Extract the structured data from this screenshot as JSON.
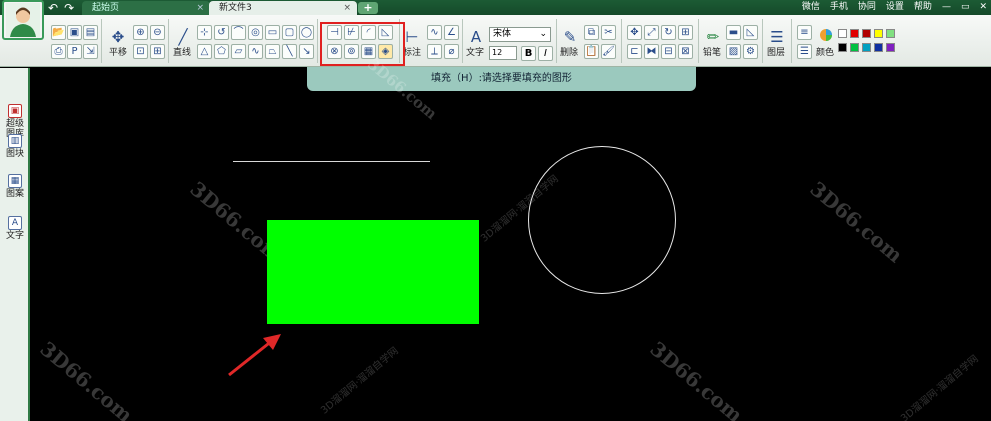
{
  "titlebar": {
    "tabs": [
      {
        "label": "起始页",
        "close": "×"
      },
      {
        "label": "新文件3",
        "close": "×"
      }
    ],
    "add_tab": "+",
    "right_items": [
      "微信",
      "手机",
      "协同",
      "设置",
      "帮助"
    ],
    "window_controls": [
      "—",
      "▭",
      "✕"
    ]
  },
  "ribbon": {
    "pan_label": "平移",
    "line_label": "直线",
    "dimension_label": "标注",
    "text_label": "文字",
    "font_name": "宋体",
    "font_size": "12",
    "bold": "B",
    "italic": "I",
    "delete_label": "删除",
    "pencil_label": "铅笔",
    "layer_label": "图层",
    "color_label": "颜色",
    "palette": [
      "#ffffff",
      "#e00000",
      "#b00000",
      "#ffff00",
      "#80e080",
      "#000000",
      "#00c040",
      "#00a0c0",
      "#1030a0",
      "#8020c0"
    ]
  },
  "tooltip": {
    "text": "填充（H）:请选择要填充的图形"
  },
  "left_panel": {
    "items": [
      "超级图库",
      "图块",
      "图案",
      "文字"
    ]
  },
  "canvas": {
    "fill_color": "#00ff00",
    "watermark": "3D66.com",
    "watermark_cn": "3D溜溜网·溜溜自学网"
  }
}
